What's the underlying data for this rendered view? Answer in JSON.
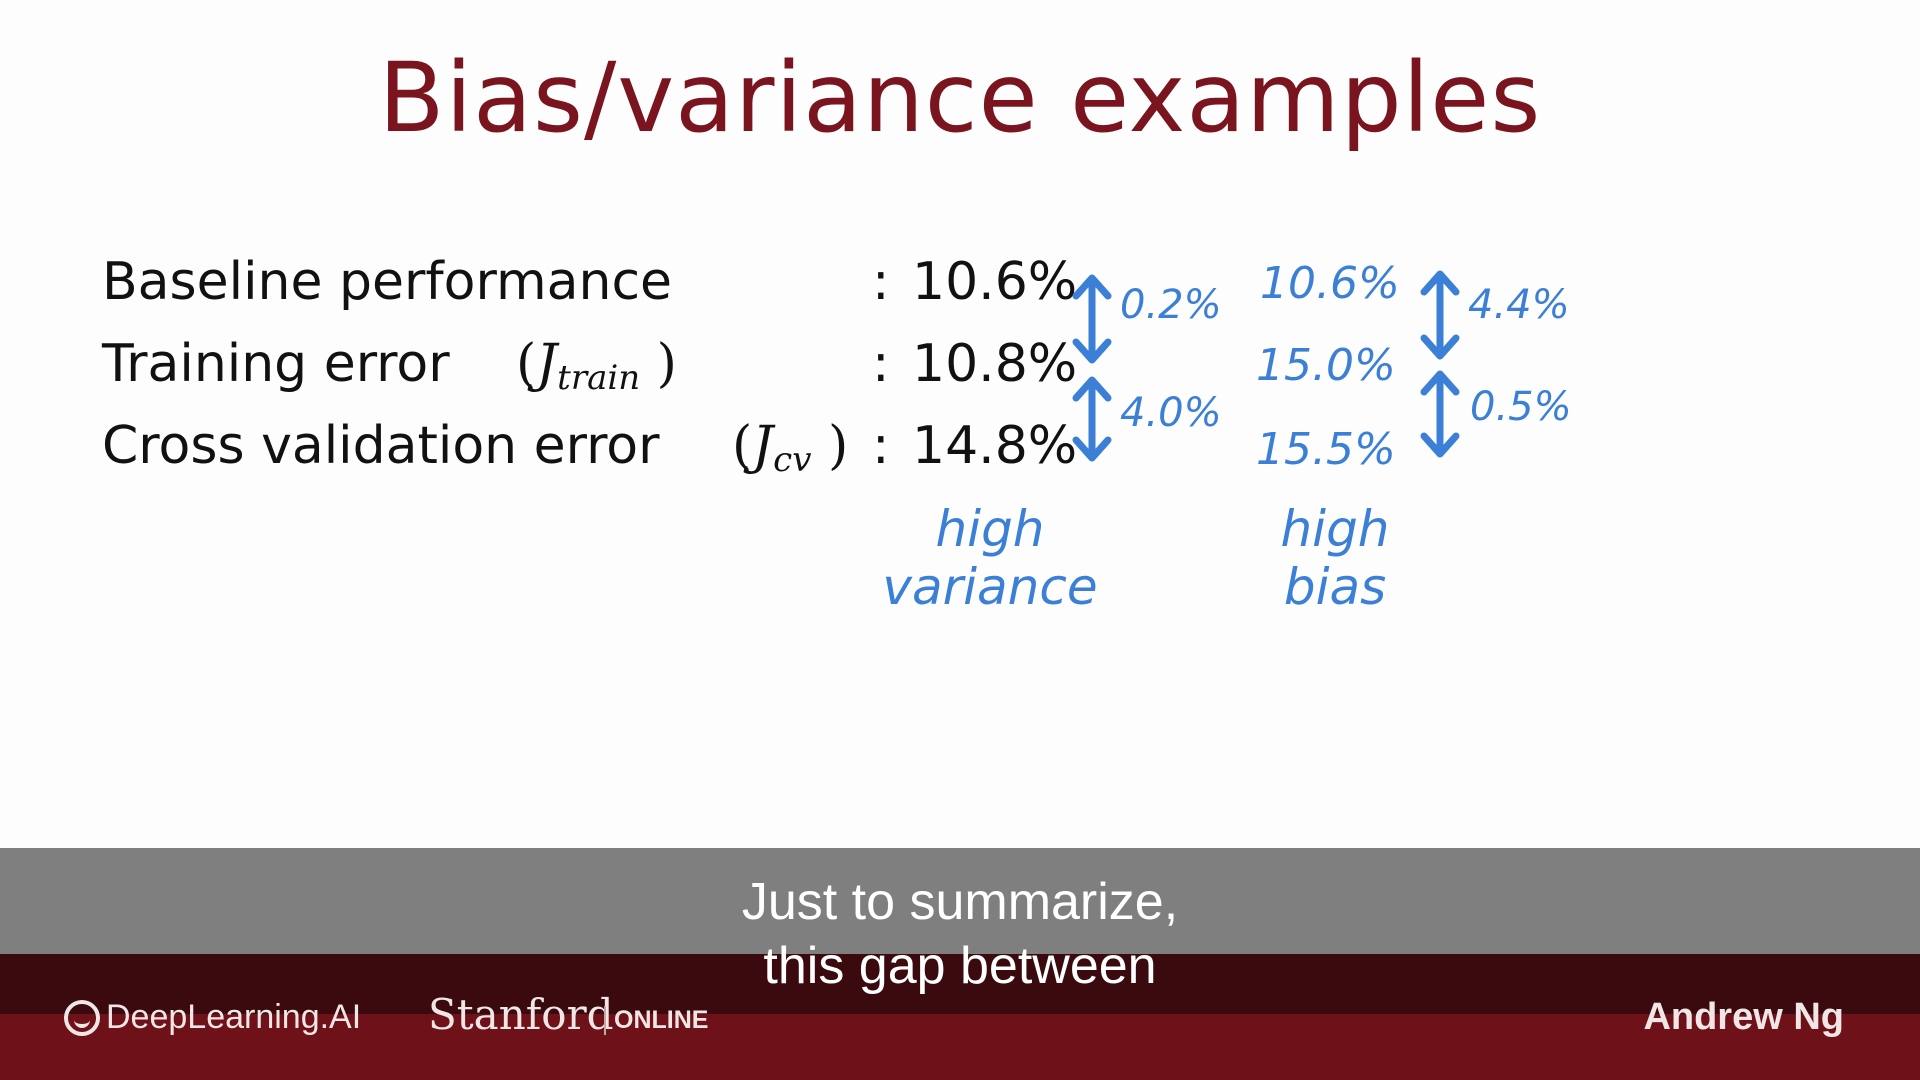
{
  "slide": {
    "title": "Bias/variance examples",
    "rows": [
      {
        "label": "Baseline performance",
        "symbol": "",
        "value": "10.6%"
      },
      {
        "label": "Training error",
        "symbol_main": "J",
        "symbol_sub": "train",
        "value": "10.8%"
      },
      {
        "label": "Cross validation error",
        "symbol_main": "J",
        "symbol_sub": "cv",
        "value": "14.8%"
      }
    ],
    "colon": ":",
    "paren_open": "(",
    "paren_close": ")",
    "annotation_left": {
      "gap1": "0.2%",
      "gap2": "4.0%",
      "label_line1": "high",
      "label_line2": "variance"
    },
    "annotation_right": {
      "values": [
        "10.6%",
        "15.0%",
        "15.5%"
      ],
      "gap1": "4.4%",
      "gap2": "0.5%",
      "label_line1": "high",
      "label_line2": "bias"
    },
    "annotation_color": "#3b7fd6",
    "title_color": "#7a1520"
  },
  "caption": {
    "line1": "Just to summarize,",
    "line2": "this gap between"
  },
  "footer": {
    "logo_deeplearning": "DeepLearning.AI",
    "logo_stanford": "Stanford",
    "logo_online": "ONLINE",
    "presenter": "Andrew Ng",
    "color": "#6e1119"
  }
}
